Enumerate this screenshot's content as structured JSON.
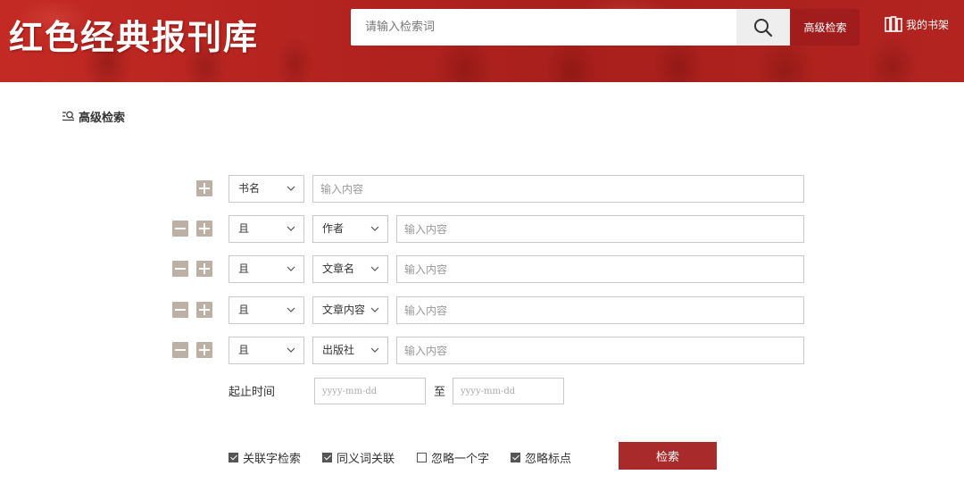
{
  "header": {
    "logo_text": "红色经典报刊库",
    "search_placeholder": "请输入检索词",
    "search_icon": "search-icon",
    "advanced_label": "高级检索",
    "bookshelf_label": "我的书架",
    "bookshelf_icon": "bookshelf-icon",
    "brand_color": "#b3231f"
  },
  "page": {
    "heading": "高级检索",
    "heading_icon": "advanced-search-icon"
  },
  "rows": [
    {
      "logic": null,
      "field": "书名",
      "placeholder": "输入内容"
    },
    {
      "logic": "且",
      "field": "作者",
      "placeholder": "输入内容"
    },
    {
      "logic": "且",
      "field": "文章名",
      "placeholder": "输入内容"
    },
    {
      "logic": "且",
      "field": "文章内容",
      "placeholder": "输入内容"
    },
    {
      "logic": "且",
      "field": "出版社",
      "placeholder": "输入内容"
    }
  ],
  "date_range": {
    "label": "起止时间",
    "from_placeholder": "yyyy-mm-dd",
    "separator": "至",
    "to_placeholder": "yyyy-mm-dd"
  },
  "options": [
    {
      "label": "关联字检索",
      "checked": true
    },
    {
      "label": "同义词关联",
      "checked": true
    },
    {
      "label": "忽略一个字",
      "checked": false
    },
    {
      "label": "忽略标点",
      "checked": true
    }
  ],
  "submit_label": "检索"
}
